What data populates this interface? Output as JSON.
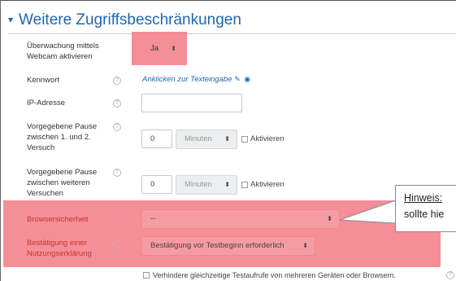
{
  "section": {
    "title": "Weitere Zugriffsbeschränkungen",
    "chevron": "chevron-down-icon"
  },
  "rows": {
    "webcam": {
      "label_line1": "Überwachung mittels",
      "label_line2": "Webcam aktivieren",
      "select_value": "Ja"
    },
    "password": {
      "label": "Kennwort",
      "link_text": "Anklicken zur Texteingabe"
    },
    "ip": {
      "label": "IP-Adresse",
      "value": ""
    },
    "pause1": {
      "label_line1": "Vorgegebene Pause",
      "label_line2": "zwischen 1. und 2.",
      "label_line3": "Versuch",
      "number": "0",
      "unit": "Minuten",
      "checkbox_label": "Aktivieren"
    },
    "pause2": {
      "label_line1": "Vorgegebene Pause",
      "label_line2": "zwischen weiteren",
      "label_line3": "Versuchen",
      "number": "0",
      "unit": "Minuten",
      "checkbox_label": "Aktivieren"
    },
    "browser": {
      "label": "Browsersicherheit",
      "select_value": "--"
    },
    "consent": {
      "label_line1": "Bestätigung einer",
      "label_line2": "Nutzungserklärung",
      "select_value": "Bestätigung vor Testbeginn erforderlich"
    },
    "concurrent": {
      "checkbox_label": "Verhindere gleichzeitige Testaufrufe von mehreren Geräten oder Browsern."
    }
  },
  "callout": {
    "heading": "Hinweis:",
    "line2": "sollte hie"
  },
  "colors": {
    "accent": "#1f67b1",
    "highlight": "#f47a85"
  }
}
